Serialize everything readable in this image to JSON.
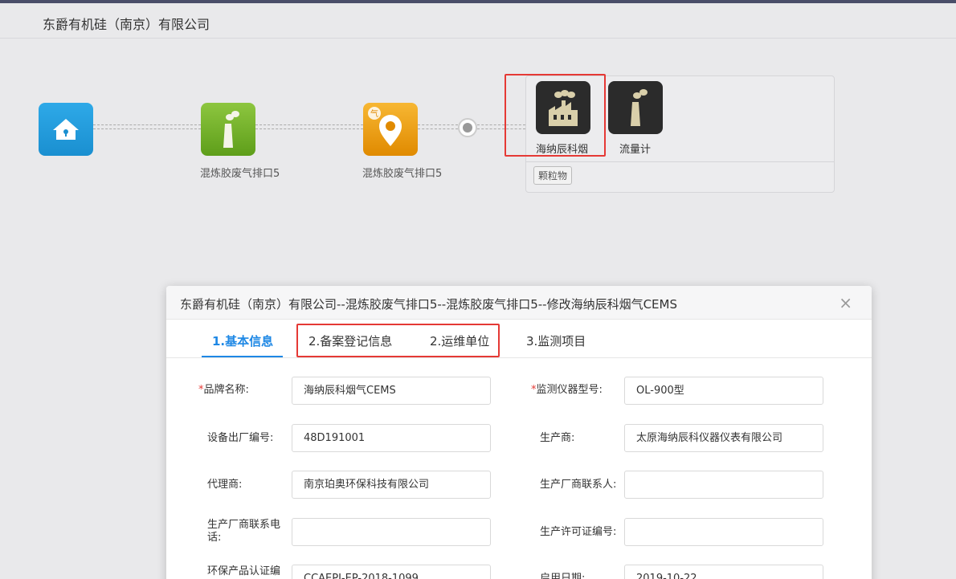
{
  "header": {
    "title": "东爵有机硅（南京）有限公司"
  },
  "flow": {
    "nodes": [
      {
        "label": ""
      },
      {
        "label": "混炼胶废气排口5"
      },
      {
        "label": "混炼胶废气排口5"
      }
    ],
    "devices": [
      {
        "label": "海纳辰科烟"
      },
      {
        "label": "流量计"
      }
    ],
    "tag": "颗粒物"
  },
  "modal": {
    "title": "东爵有机硅（南京）有限公司--混炼胶废气排口5--混炼胶废气排口5--修改海纳辰科烟气CEMS",
    "close": "×",
    "tabs": [
      "1.基本信息",
      "2.备案登记信息",
      "2.运维单位",
      "3.监测项目"
    ],
    "form": {
      "brand_label": "品牌名称:",
      "brand_value": "海纳辰科烟气CEMS",
      "model_label": "监测仪器型号:",
      "model_value": "OL-900型",
      "serial_label": "设备出厂编号:",
      "serial_value": "48D191001",
      "maker_label": "生产商:",
      "maker_value": "太原海纳辰科仪器仪表有限公司",
      "agent_label": "代理商:",
      "agent_value": "南京珀奥环保科技有限公司",
      "maker_contact_label": "生产厂商联系人:",
      "maker_contact_value": "",
      "maker_phone_label": "生产厂商联系电话:",
      "maker_phone_value": "",
      "license_label": "生产许可证编号:",
      "license_value": "",
      "cert_label": "环保产品认证编",
      "cert_value": "CCAEPI-EP-2018-1099",
      "start_label": "启用日期:",
      "start_value": "2019-10-22"
    }
  }
}
